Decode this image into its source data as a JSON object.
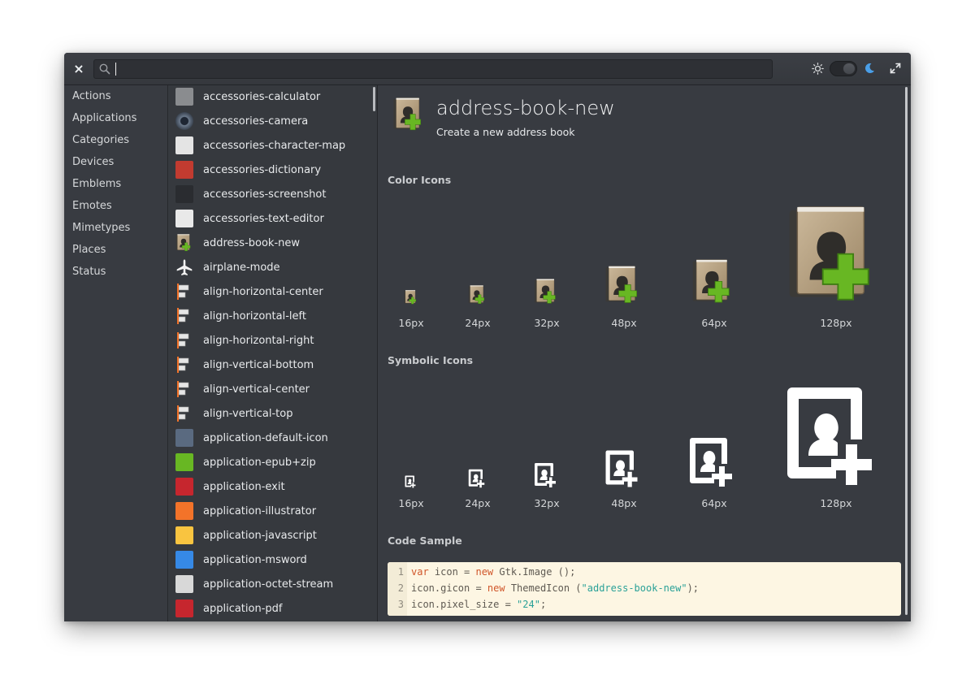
{
  "header": {
    "close_label": "×",
    "search_value": "",
    "search_placeholder": "",
    "close_icon": "close-icon",
    "search_icon": "search-icon",
    "light_icon": "sun-icon",
    "dark_icon": "moon-icon",
    "dark_mode": true,
    "fullscreen_icon": "fullscreen-icon",
    "accent_color": "#4a9fe8"
  },
  "sidebar": {
    "items": [
      "Actions",
      "Applications",
      "Categories",
      "Devices",
      "Emblems",
      "Emotes",
      "Mimetypes",
      "Places",
      "Status"
    ]
  },
  "icon_list": {
    "items": [
      {
        "name": "accessories-calculator",
        "icon": "calculator-icon",
        "color": "#8a8c8f"
      },
      {
        "name": "accessories-camera",
        "icon": "camera-icon",
        "color": "#4d5a6b"
      },
      {
        "name": "accessories-character-map",
        "icon": "character-map-icon",
        "color": "#e4e4e4"
      },
      {
        "name": "accessories-dictionary",
        "icon": "dictionary-icon",
        "color": "#c23b30"
      },
      {
        "name": "accessories-screenshot",
        "icon": "screenshot-icon",
        "color": "#2a2c30"
      },
      {
        "name": "accessories-text-editor",
        "icon": "text-editor-icon",
        "color": "#e9e9e9"
      },
      {
        "name": "address-book-new",
        "icon": "address-book-icon",
        "color": "#b09a7c"
      },
      {
        "name": "airplane-mode",
        "icon": "airplane-icon",
        "color": "#f2f2f2"
      },
      {
        "name": "align-horizontal-center",
        "icon": "align-horizontal-center-icon",
        "color": "#f37329"
      },
      {
        "name": "align-horizontal-left",
        "icon": "align-horizontal-left-icon",
        "color": "#f37329"
      },
      {
        "name": "align-horizontal-right",
        "icon": "align-horizontal-right-icon",
        "color": "#f37329"
      },
      {
        "name": "align-vertical-bottom",
        "icon": "align-vertical-bottom-icon",
        "color": "#f37329"
      },
      {
        "name": "align-vertical-center",
        "icon": "align-vertical-center-icon",
        "color": "#f37329"
      },
      {
        "name": "align-vertical-top",
        "icon": "align-vertical-top-icon",
        "color": "#f37329"
      },
      {
        "name": "application-default-icon",
        "icon": "gear-icon",
        "color": "#5a6a80"
      },
      {
        "name": "application-epub+zip",
        "icon": "epub-icon",
        "color": "#68b723"
      },
      {
        "name": "application-exit",
        "icon": "exit-icon",
        "color": "#c6262e"
      },
      {
        "name": "application-illustrator",
        "icon": "illustrator-icon",
        "color": "#f37329"
      },
      {
        "name": "application-javascript",
        "icon": "javascript-icon",
        "color": "#f9c440"
      },
      {
        "name": "application-msword",
        "icon": "msword-icon",
        "color": "#3689e6"
      },
      {
        "name": "application-octet-stream",
        "icon": "binary-file-icon",
        "color": "#d8d8d8"
      },
      {
        "name": "application-pdf",
        "icon": "pdf-icon",
        "color": "#c6262e"
      }
    ]
  },
  "detail": {
    "title": "address-book-new",
    "description": "Create a new address book",
    "color_section_title": "Color Icons",
    "symbolic_section_title": "Symbolic Icons",
    "code_section_title": "Code Sample",
    "sizes": [
      "16px",
      "24px",
      "32px",
      "48px",
      "64px",
      "128px"
    ],
    "code_lines": [
      {
        "n": "1",
        "parts": [
          {
            "t": "var",
            "c": "kw"
          },
          {
            "t": " icon = ",
            "c": ""
          },
          {
            "t": "new",
            "c": "kw"
          },
          {
            "t": " Gtk.Image ();",
            "c": ""
          }
        ]
      },
      {
        "n": "2",
        "parts": [
          {
            "t": "icon.gicon = ",
            "c": ""
          },
          {
            "t": "new",
            "c": "kw"
          },
          {
            "t": " ThemedIcon (",
            "c": ""
          },
          {
            "t": "\"address-book-new\"",
            "c": "str"
          },
          {
            "t": ");",
            "c": ""
          }
        ]
      },
      {
        "n": "3",
        "parts": [
          {
            "t": "icon.pixel_size = ",
            "c": ""
          },
          {
            "t": "\"24\"",
            "c": "str"
          },
          {
            "t": ";",
            "c": ""
          }
        ]
      }
    ]
  }
}
